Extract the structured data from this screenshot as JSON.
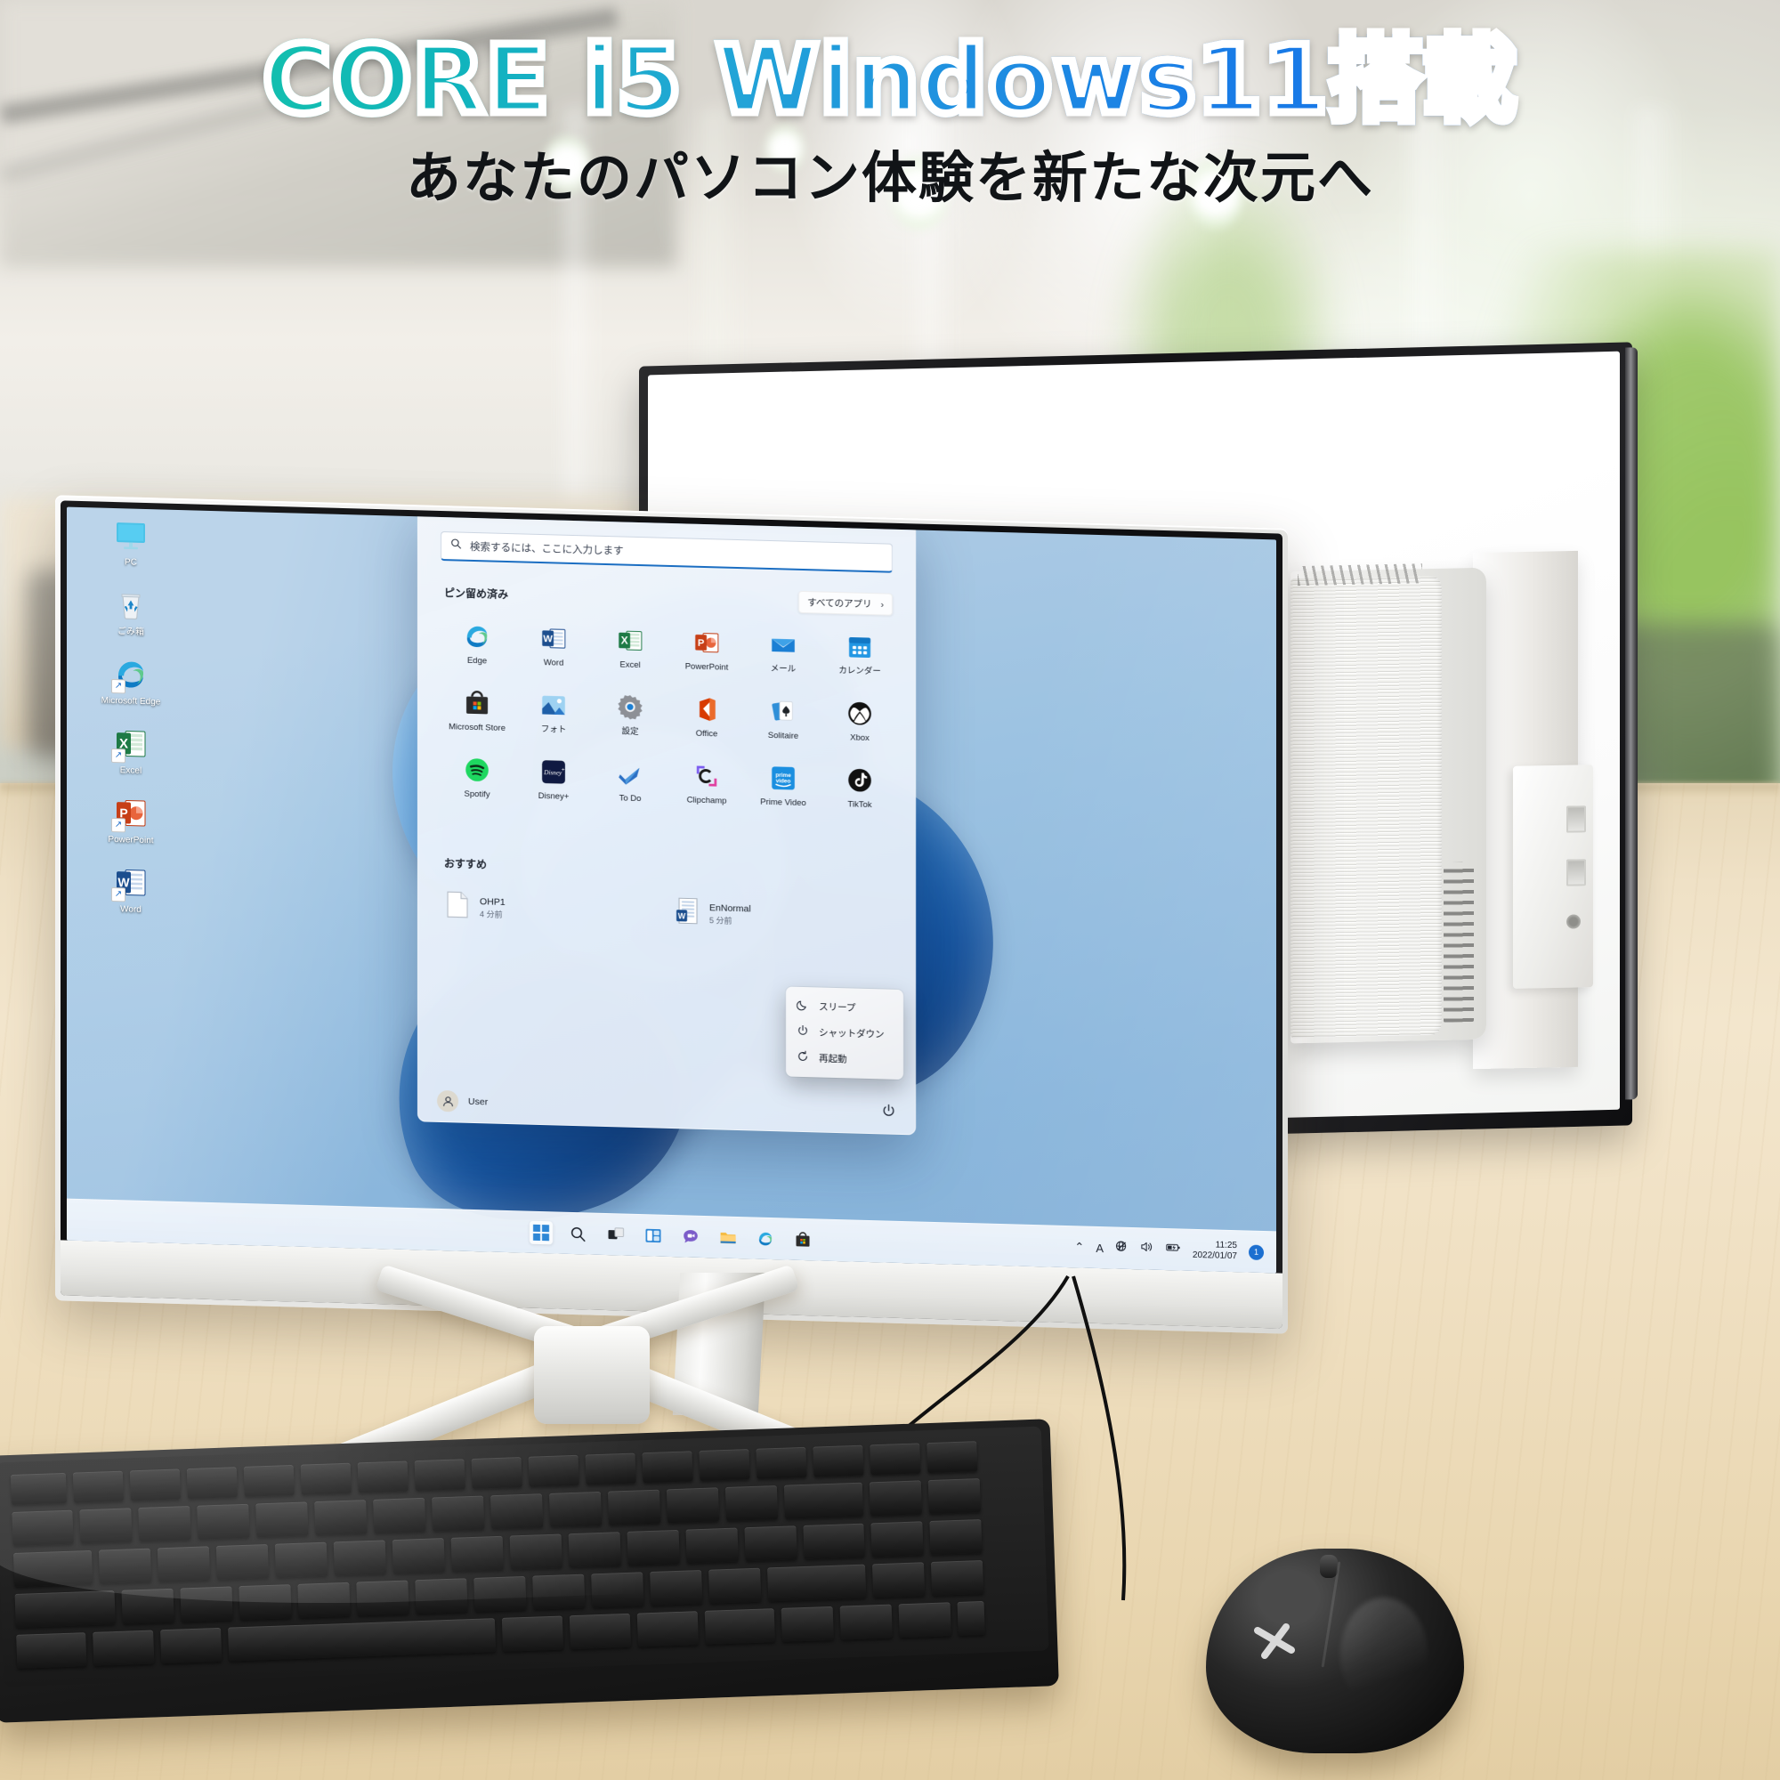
{
  "headline": {
    "main": "CORE i5  Windows11搭載",
    "sub": "あなたのパソコン体験を新たな次元へ",
    "gradient_from": "#13bfae",
    "gradient_to": "#1470e8",
    "stroke_color": "#ffffff",
    "sub_color": "#111417"
  },
  "desktop": {
    "icons": [
      {
        "label": "PC",
        "icon": "monitor-icon"
      },
      {
        "label": "ごみ箱",
        "icon": "recycle-bin-icon"
      },
      {
        "label": "Microsoft Edge",
        "icon": "edge-icon"
      },
      {
        "label": "Excel",
        "icon": "excel-icon"
      },
      {
        "label": "PowerPoint",
        "icon": "powerpoint-icon"
      },
      {
        "label": "Word",
        "icon": "word-icon"
      }
    ]
  },
  "start_menu": {
    "search_placeholder": "検索するには、ここに入力します",
    "search_icon": "search-icon",
    "pinned_header": "ピン留め済み",
    "all_apps_label": "すべてのアプリ",
    "all_apps_chevron": "›",
    "pinned_apps": [
      {
        "name": "Edge",
        "icon": "edge-icon"
      },
      {
        "name": "Word",
        "icon": "word-icon"
      },
      {
        "name": "Excel",
        "icon": "excel-icon"
      },
      {
        "name": "PowerPoint",
        "icon": "powerpoint-icon"
      },
      {
        "name": "メール",
        "icon": "mail-icon"
      },
      {
        "name": "カレンダー",
        "icon": "calendar-icon"
      },
      {
        "name": "Microsoft Store",
        "icon": "store-icon"
      },
      {
        "name": "フォト",
        "icon": "photos-icon"
      },
      {
        "name": "設定",
        "icon": "settings-gear-icon"
      },
      {
        "name": "Office",
        "icon": "office-icon"
      },
      {
        "name": "Solitaire",
        "icon": "solitaire-icon"
      },
      {
        "name": "Xbox",
        "icon": "xbox-icon"
      },
      {
        "name": "Spotify",
        "icon": "spotify-icon"
      },
      {
        "name": "Disney+",
        "icon": "disney-plus-icon"
      },
      {
        "name": "To Do",
        "icon": "todo-check-icon"
      },
      {
        "name": "Clipchamp",
        "icon": "clipchamp-icon"
      },
      {
        "name": "Prime Video",
        "icon": "prime-video-icon"
      },
      {
        "name": "TikTok",
        "icon": "tiktok-icon"
      }
    ],
    "recommended_header": "おすすめ",
    "recommended": [
      {
        "title": "OHP1",
        "subtitle": "4 分前",
        "icon": "blank-document-icon"
      },
      {
        "title": "EnNormal",
        "subtitle": "5 分前",
        "icon": "word-document-icon"
      }
    ],
    "power_menu": [
      {
        "label": "スリープ",
        "icon": "moon-icon"
      },
      {
        "label": "シャットダウン",
        "icon": "power-icon"
      },
      {
        "label": "再起動",
        "icon": "restart-icon"
      }
    ],
    "user": {
      "name": "User",
      "icon": "user-avatar-icon"
    },
    "power_button_icon": "power-icon"
  },
  "taskbar": {
    "items": [
      {
        "name": "Start",
        "icon": "windows-start-icon"
      },
      {
        "name": "Search",
        "icon": "search-icon"
      },
      {
        "name": "Task View",
        "icon": "task-view-icon"
      },
      {
        "name": "Widgets",
        "icon": "widgets-icon"
      },
      {
        "name": "Chat",
        "icon": "chat-icon"
      },
      {
        "name": "File Explorer",
        "icon": "folder-icon"
      },
      {
        "name": "Microsoft Edge",
        "icon": "edge-icon"
      },
      {
        "name": "Microsoft Store",
        "icon": "store-icon"
      }
    ],
    "tray": {
      "chevron": "⌃",
      "ime": "A",
      "network_icon": "network-disconnected-icon",
      "volume_icon": "volume-icon",
      "battery_icon": "battery-charging-icon",
      "time": "11:25",
      "date": "2022/01/07",
      "notification_count": "1"
    }
  },
  "hardware": {
    "mouse_logo": "x-logo-icon",
    "monitor_name": "all-in-one-monitor",
    "rear_monitor_name": "secondary-monitor",
    "pc_module_name": "pc-module",
    "keyboard_name": "keyboard"
  }
}
